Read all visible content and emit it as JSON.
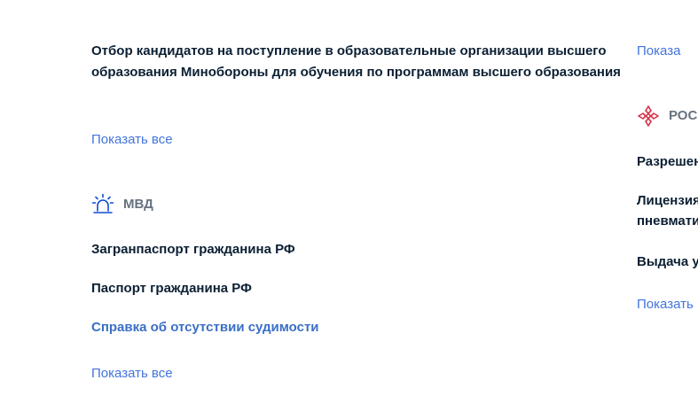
{
  "left_column": {
    "top_service": "Отбор кандидатов на поступление в образовательные организации высшего образования Минобороны для обучения по программам высшего образования",
    "top_show_all": "Показать все",
    "mvd": {
      "title": "МВД",
      "icon": "siren-icon",
      "services": [
        "Загранпаспорт гражданина РФ",
        "Паспорт гражданина РФ"
      ],
      "highlighted_service": "Справка об отсутствии судимости",
      "show_all": "Показать все"
    }
  },
  "right_column": {
    "top_show_all": "Показа",
    "section_title": "РОС",
    "section_icon": "rosgvardia-emblem-icon",
    "services": [
      "Разрешен",
      "Лицензия",
      "пневмати",
      "Выдача у"
    ],
    "show_all": "Показать"
  },
  "colors": {
    "text": "#0b1f33",
    "link": "#0d4cd3",
    "heading_gray": "#66727f",
    "icon_blue": "#0d4cd3",
    "emblem_red": "#d6334a"
  }
}
